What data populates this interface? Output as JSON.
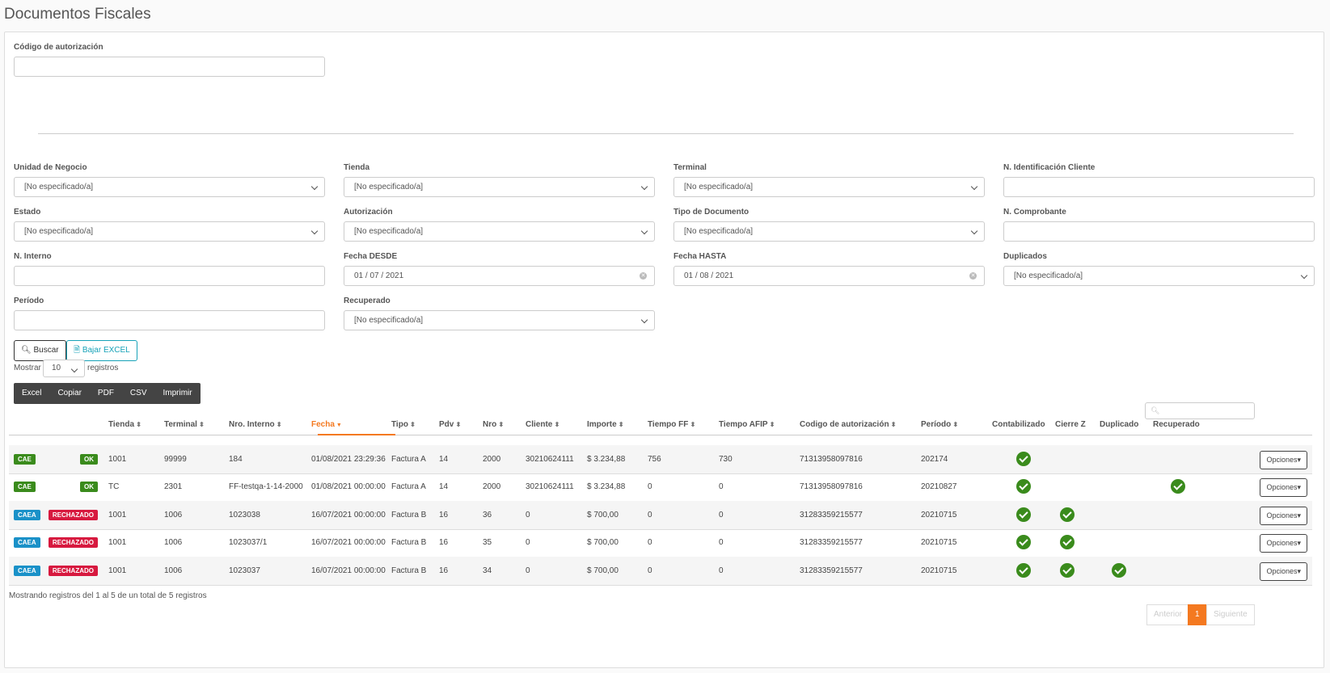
{
  "page": {
    "title": "Documentos Fiscales"
  },
  "filters": {
    "codigo_autorizacion": {
      "label": "Código de autorización",
      "value": ""
    },
    "unidad_negocio": {
      "label": "Unidad de Negocio",
      "value": "[No especificado/a]"
    },
    "tienda": {
      "label": "Tienda",
      "value": "[No especificado/a]"
    },
    "terminal": {
      "label": "Terminal",
      "value": "[No especificado/a]"
    },
    "n_identificacion_cliente": {
      "label": "N. Identificación Cliente",
      "value": ""
    },
    "estado": {
      "label": "Estado",
      "value": "[No especificado/a]"
    },
    "autorizacion": {
      "label": "Autorización",
      "value": "[No especificado/a]"
    },
    "tipo_documento": {
      "label": "Tipo de Documento",
      "value": "[No especificado/a]"
    },
    "n_comprobante": {
      "label": "N. Comprobante",
      "value": ""
    },
    "n_interno": {
      "label": "N. Interno",
      "value": ""
    },
    "fecha_desde": {
      "label": "Fecha DESDE",
      "value": "01 / 07 / 2021"
    },
    "fecha_hasta": {
      "label": "Fecha HASTA",
      "value": "01 / 08 / 2021"
    },
    "duplicados": {
      "label": "Duplicados",
      "value": "[No especificado/a]"
    },
    "periodo": {
      "label": "Período",
      "value": ""
    },
    "recuperado": {
      "label": "Recuperado",
      "value": "[No especificado/a]"
    }
  },
  "actions": {
    "buscar": "Buscar",
    "bajar_excel": "Bajar EXCEL"
  },
  "length_menu": {
    "mostrar": "Mostrar",
    "value": "10",
    "registros": "registros"
  },
  "export_buttons": [
    "Excel",
    "Copiar",
    "PDF",
    "CSV",
    "Imprimir"
  ],
  "table": {
    "headers": [
      "Tienda",
      "Terminal",
      "Nro. Interno",
      "Fecha",
      "Tipo",
      "Pdv",
      "Nro",
      "Cliente",
      "Importe",
      "Tiempo FF",
      "Tiempo AFIP",
      "Codigo de autorización",
      "Período",
      "Contabilizado",
      "Cierre Z",
      "Duplicado",
      "Recuperado"
    ],
    "rows": [
      {
        "auth": "CAE",
        "status": "OK",
        "tienda": "1001",
        "terminal": "99999",
        "nro_interno": "184",
        "fecha": "01/08/2021 23:29:36",
        "tipo": "Factura A",
        "pdv": "14",
        "nro": "2000",
        "cliente": "30210624111",
        "importe": "$ 3.234,88",
        "tiempo_ff": "756",
        "tiempo_afip": "730",
        "codigo": "71313958097816",
        "periodo": "202174",
        "contabilizado": true,
        "cierre_z": false,
        "duplicado": false,
        "recuperado": false,
        "opciones": "Opciones"
      },
      {
        "auth": "CAE",
        "status": "OK",
        "tienda": "TC",
        "terminal": "2301",
        "nro_interno": "FF-testqa-1-14-2000",
        "fecha": "01/08/2021 00:00:00",
        "tipo": "Factura A",
        "pdv": "14",
        "nro": "2000",
        "cliente": "30210624111",
        "importe": "$ 3.234,88",
        "tiempo_ff": "0",
        "tiempo_afip": "0",
        "codigo": "71313958097816",
        "periodo": "20210827",
        "contabilizado": true,
        "cierre_z": false,
        "duplicado": false,
        "recuperado": true,
        "opciones": "Opciones"
      },
      {
        "auth": "CAEA",
        "status": "RECHAZADO",
        "tienda": "1001",
        "terminal": "1006",
        "nro_interno": "1023038",
        "fecha": "16/07/2021 00:00:00",
        "tipo": "Factura B",
        "pdv": "16",
        "nro": "36",
        "cliente": "0",
        "importe": "$ 700,00",
        "tiempo_ff": "0",
        "tiempo_afip": "0",
        "codigo": "31283359215577",
        "periodo": "20210715",
        "contabilizado": true,
        "cierre_z": true,
        "duplicado": false,
        "recuperado": false,
        "opciones": "Opciones"
      },
      {
        "auth": "CAEA",
        "status": "RECHAZADO",
        "tienda": "1001",
        "terminal": "1006",
        "nro_interno": "1023037/1",
        "fecha": "16/07/2021 00:00:00",
        "tipo": "Factura B",
        "pdv": "16",
        "nro": "35",
        "cliente": "0",
        "importe": "$ 700,00",
        "tiempo_ff": "0",
        "tiempo_afip": "0",
        "codigo": "31283359215577",
        "periodo": "20210715",
        "contabilizado": true,
        "cierre_z": true,
        "duplicado": false,
        "recuperado": false,
        "opciones": "Opciones"
      },
      {
        "auth": "CAEA",
        "status": "RECHAZADO",
        "tienda": "1001",
        "terminal": "1006",
        "nro_interno": "1023037",
        "fecha": "16/07/2021 00:00:00",
        "tipo": "Factura B",
        "pdv": "16",
        "nro": "34",
        "cliente": "0",
        "importe": "$ 700,00",
        "tiempo_ff": "0",
        "tiempo_afip": "0",
        "codigo": "31283359215577",
        "periodo": "20210715",
        "contabilizado": true,
        "cierre_z": true,
        "duplicado": true,
        "recuperado": false,
        "opciones": "Opciones"
      }
    ]
  },
  "info": "Mostrando registros del 1 al 5 de un total de 5 registros",
  "pagination": {
    "prev": "Anterior",
    "current": "1",
    "next": "Siguiente"
  },
  "colors": {
    "accent": "#f47920",
    "success": "#3a8b1c",
    "info": "#1a91c8",
    "danger": "#d7193f"
  }
}
